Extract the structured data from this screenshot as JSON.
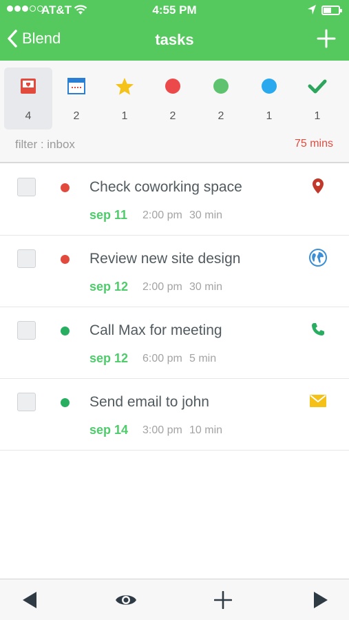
{
  "status_bar": {
    "signal_full": 3,
    "signal_total": 5,
    "carrier": "AT&T",
    "time": "4:55 PM",
    "battery_level": 0.4
  },
  "nav": {
    "back_label": "Blend",
    "title": "tasks",
    "add_icon": "plus-icon",
    "color": "#55c95e"
  },
  "filters": [
    {
      "icon": "inbox-icon",
      "count": "4",
      "selected": true,
      "color": "#e34a3e"
    },
    {
      "icon": "calendar-icon",
      "count": "2",
      "selected": false,
      "color": "#2a7fd4"
    },
    {
      "icon": "star-icon",
      "count": "1",
      "selected": false,
      "color": "#f4c219"
    },
    {
      "icon": "red-circle-icon",
      "count": "2",
      "selected": false,
      "color": "#ec4a4a"
    },
    {
      "icon": "green-circle-icon",
      "count": "2",
      "selected": false,
      "color": "#5fc26f"
    },
    {
      "icon": "blue-circle-icon",
      "count": "1",
      "selected": false,
      "color": "#2aa9ef"
    },
    {
      "icon": "checkmark-icon",
      "count": "1",
      "selected": false,
      "color": "#2da55d"
    }
  ],
  "filter_label": "filter : inbox",
  "total_mins": "75 mins",
  "tasks": [
    {
      "title": "Check coworking space",
      "date": "sep 11",
      "time": "2:00 pm",
      "duration": "30 min",
      "priority_color": "#e34a3e",
      "icon": "location-pin-icon",
      "icon_color": "#c0392b"
    },
    {
      "title": "Review new site design",
      "date": "sep 12",
      "time": "2:00 pm",
      "duration": "30 min",
      "priority_color": "#e34a3e",
      "icon": "globe-icon",
      "icon_color": "#3b8fd6"
    },
    {
      "title": "Call Max for meeting",
      "date": "sep 12",
      "time": "6:00 pm",
      "duration": "5 min",
      "priority_color": "#27ae60",
      "icon": "phone-icon",
      "icon_color": "#27ae60"
    },
    {
      "title": "Send email to john",
      "date": "sep 14",
      "time": "3:00 pm",
      "duration": "10 min",
      "priority_color": "#27ae60",
      "icon": "mail-icon",
      "icon_color": "#f5c118"
    }
  ],
  "toolbar": {
    "items": [
      "back-arrow-icon",
      "eye-icon",
      "plus-icon",
      "forward-arrow-icon"
    ]
  }
}
